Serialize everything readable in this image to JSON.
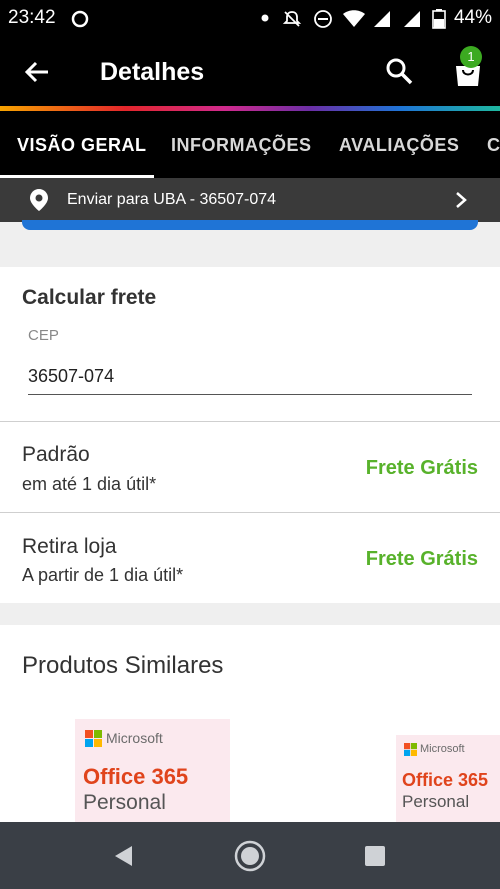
{
  "status_bar": {
    "time": "23:42",
    "battery": "44%"
  },
  "app_bar": {
    "title": "Detalhes",
    "cart_count": "1"
  },
  "tabs": [
    {
      "label": "VISÃO GERAL",
      "active": true
    },
    {
      "label": "INFORMAÇÕES",
      "active": false
    },
    {
      "label": "AVALIAÇÕES",
      "active": false
    },
    {
      "label": "C",
      "active": false
    }
  ],
  "shipping_bar": {
    "text": "Enviar para UBA - 36507-074"
  },
  "freight": {
    "title": "Calcular frete",
    "cep_label": "CEP",
    "cep_value": "36507-074",
    "options": [
      {
        "name": "Padrão",
        "eta": "em até 1 dia útil*",
        "price": "Frete Grátis"
      },
      {
        "name": "Retira loja",
        "eta": "A partir de 1 dia útil*",
        "price": "Frete Grátis"
      }
    ]
  },
  "similar": {
    "title": "Produtos Similares",
    "products": [
      {
        "brand": "Microsoft",
        "line1": "Office 365",
        "line2": "Personal"
      },
      {
        "brand": "Microsoft",
        "line1": "Office 365",
        "line2": "Personal"
      }
    ]
  },
  "colors": {
    "accent_green": "#58b22b",
    "badge_green": "#3caa21",
    "blue": "#1f74d6",
    "office_orange": "#e0441c"
  }
}
